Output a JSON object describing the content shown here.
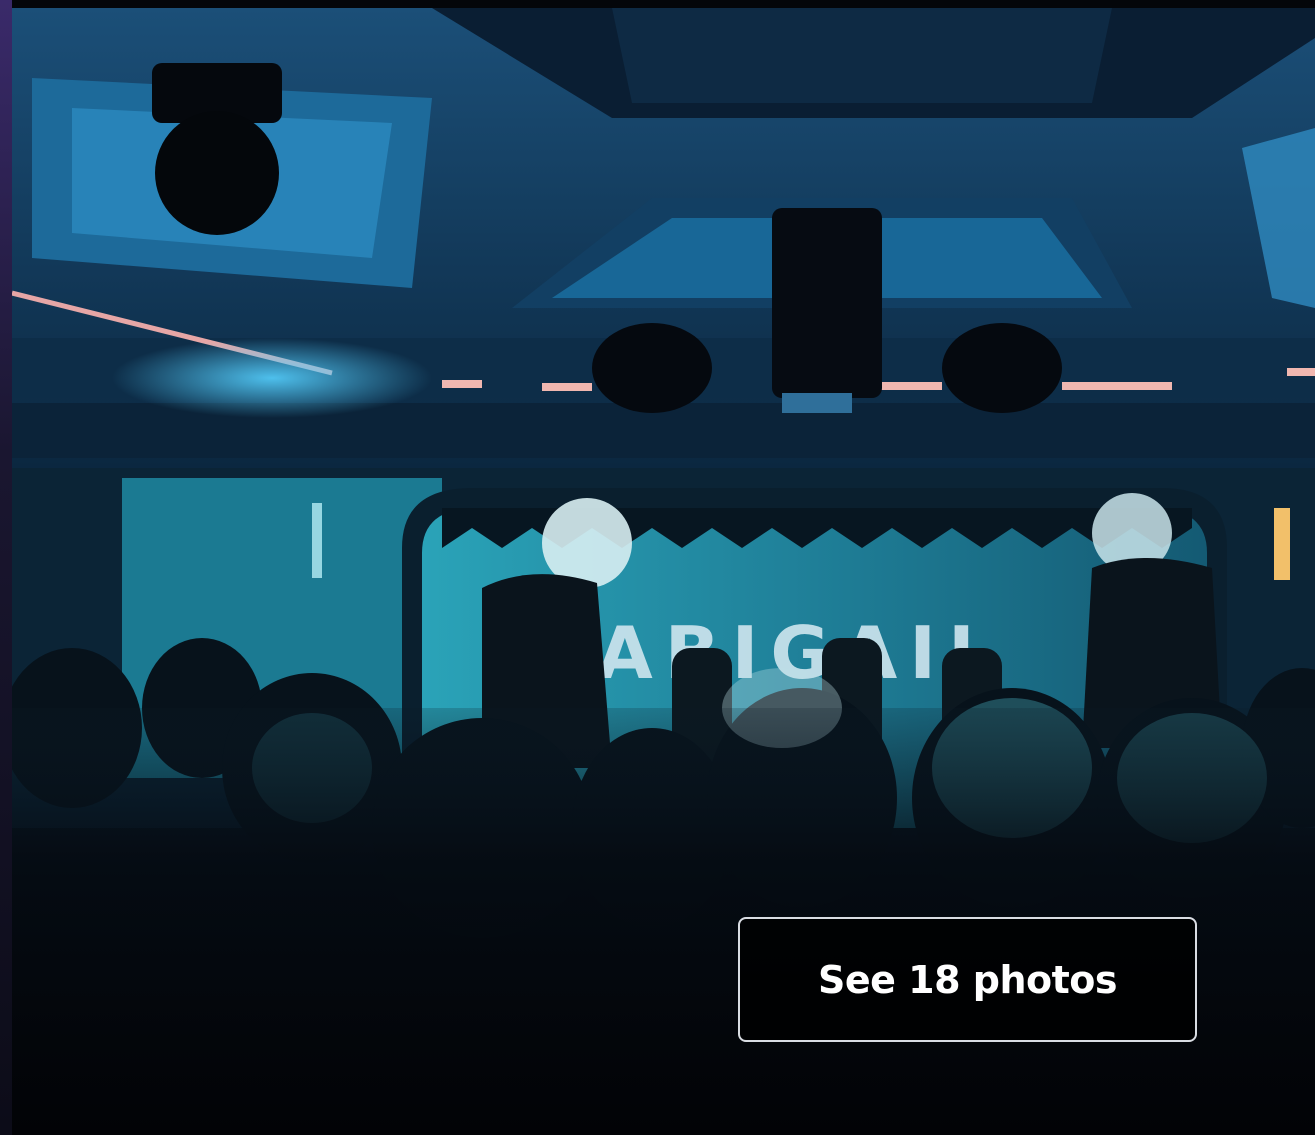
{
  "gallery": {
    "photo_alt_icon": "venue-photo",
    "stage_sign_text": "ABIGAIL",
    "see_photos_label": "See 18 photos"
  },
  "colors": {
    "button_background": "#000000",
    "button_border": "#d9dde3",
    "button_text": "#ffffff",
    "stage_light": "#45c6d8"
  }
}
